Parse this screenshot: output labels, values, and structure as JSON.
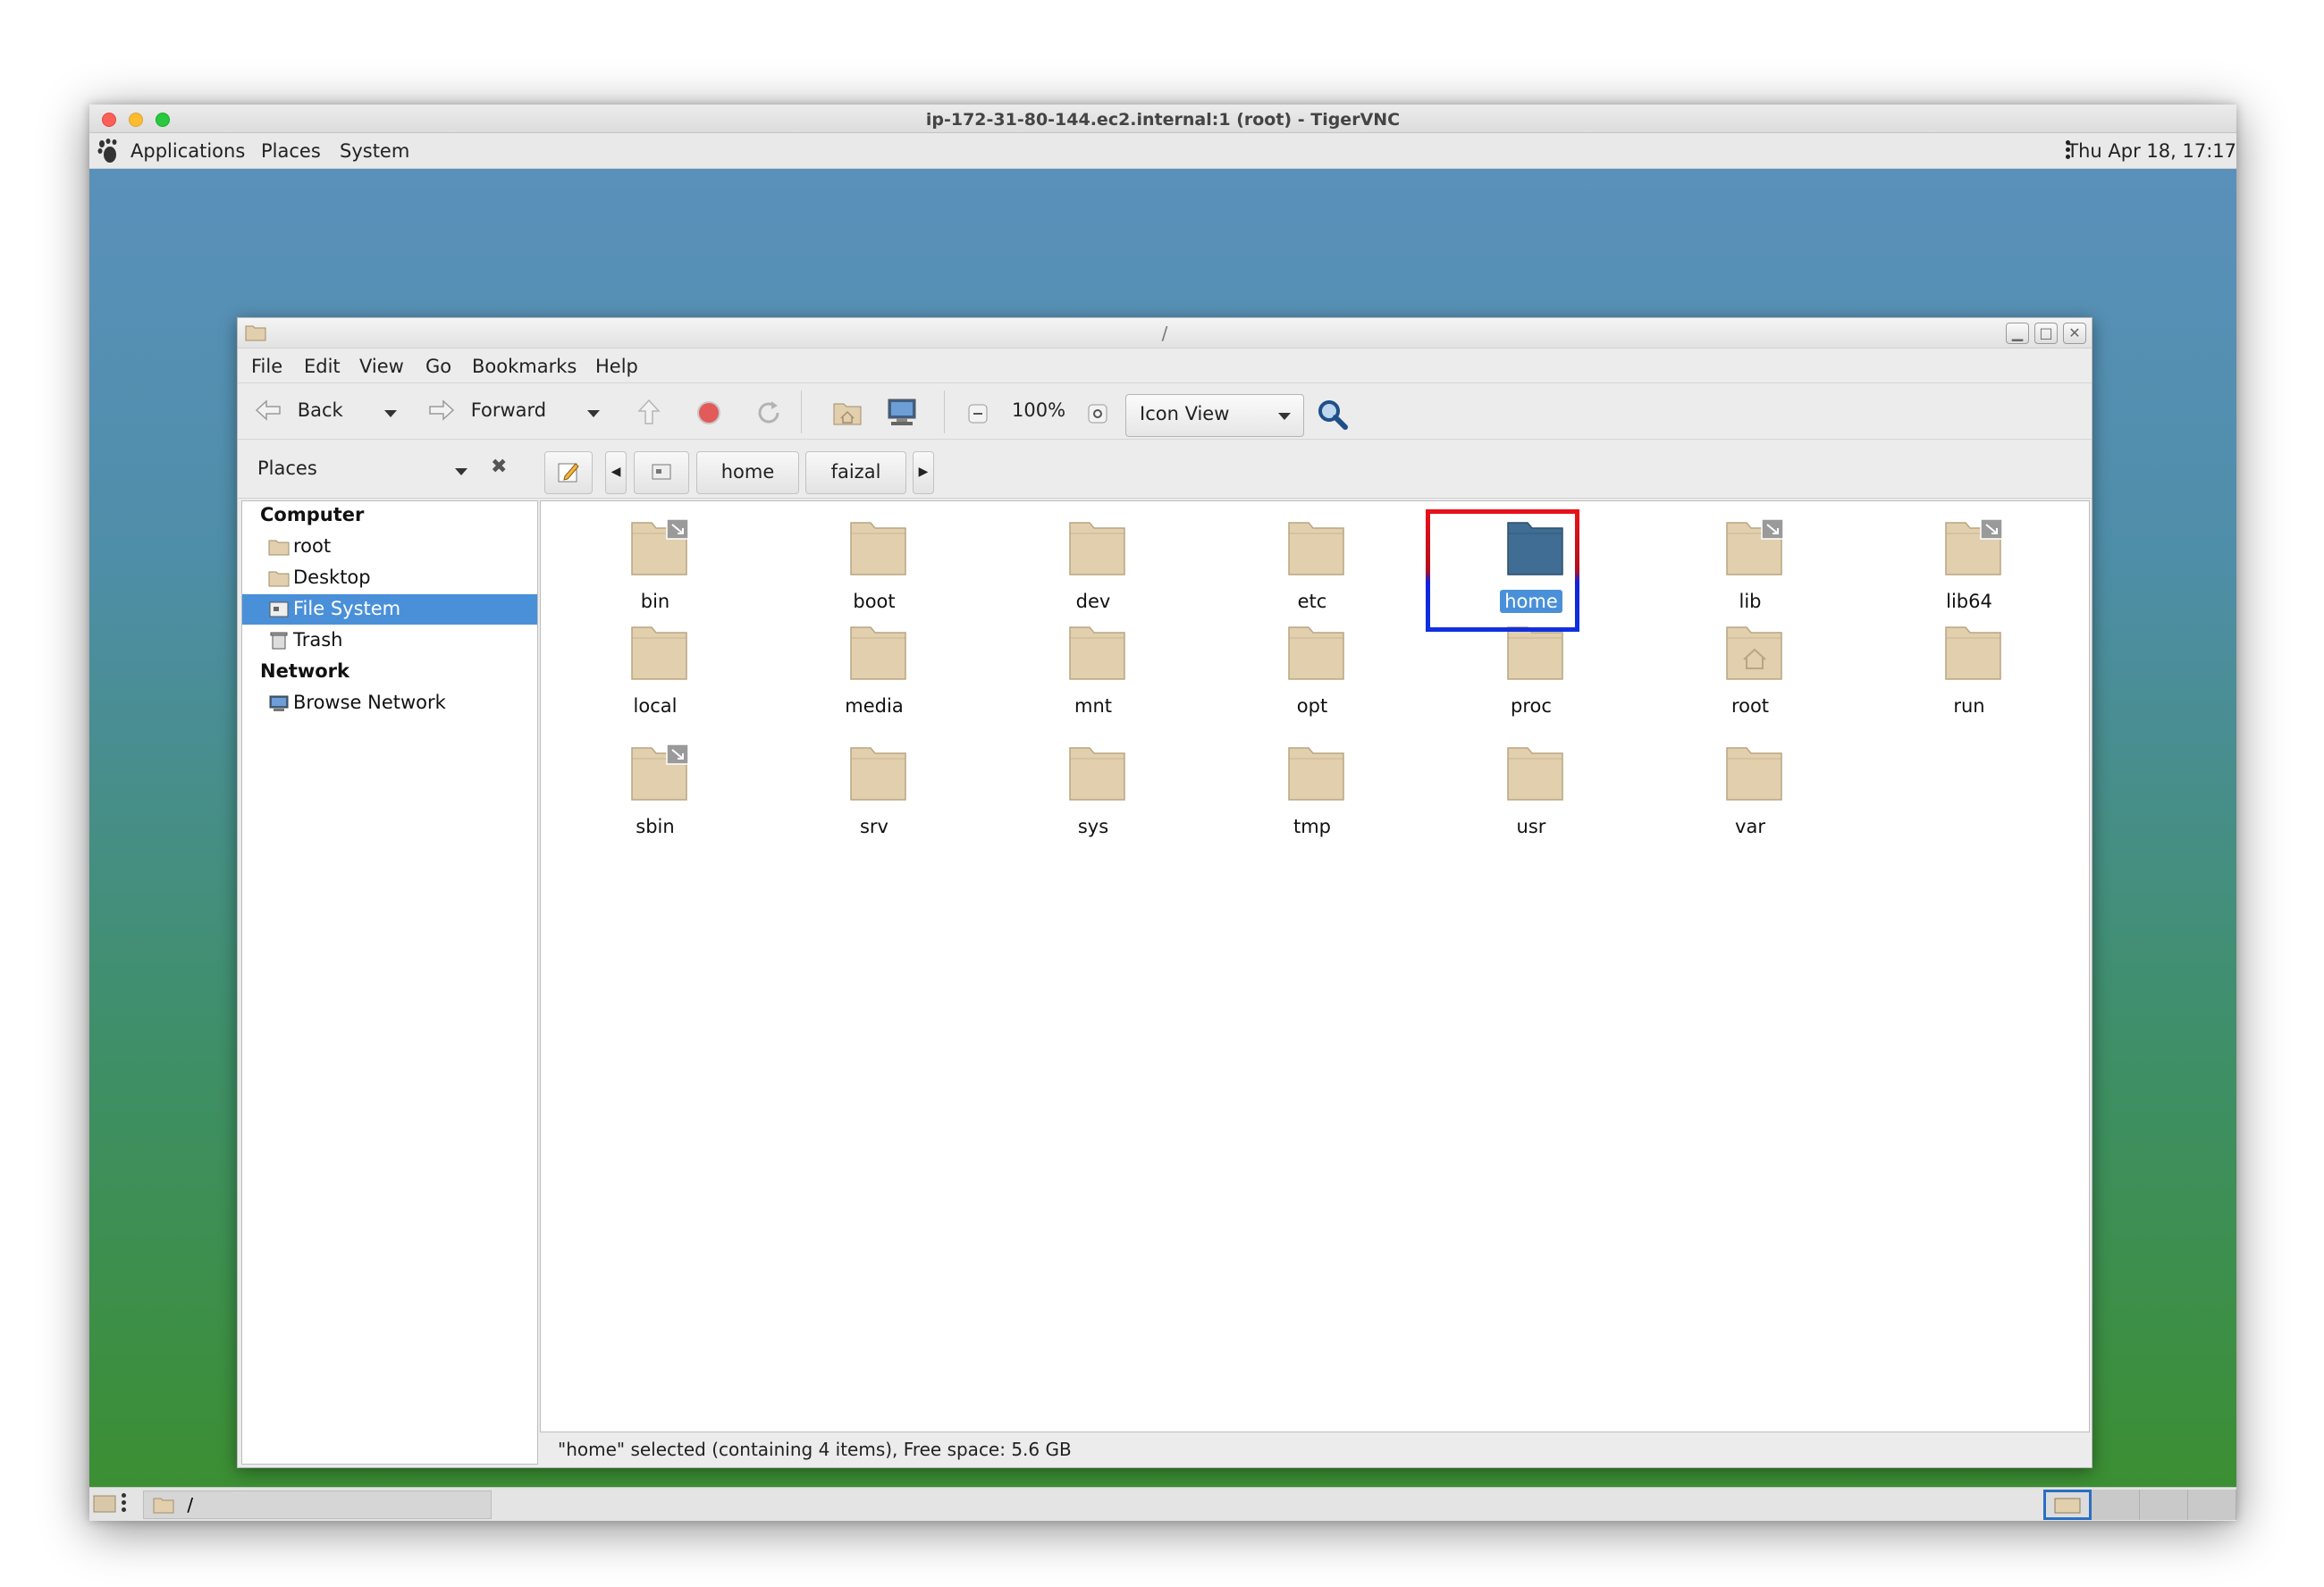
{
  "vnc": {
    "title": "ip-172-31-80-144.ec2.internal:1 (root) - TigerVNC"
  },
  "top_panel": {
    "menus": [
      "Applications",
      "Places",
      "System"
    ],
    "clock": "Thu Apr 18, 17:17"
  },
  "bottom_panel": {
    "task_label": "/"
  },
  "window": {
    "title": "/",
    "menubar": [
      "File",
      "Edit",
      "View",
      "Go",
      "Bookmarks",
      "Help"
    ],
    "toolbar": {
      "back_label": "Back",
      "forward_label": "Forward",
      "zoom_level": "100%",
      "view_mode": "Icon View"
    },
    "location": {
      "places_label": "Places",
      "breadcrumbs": [
        "home",
        "faizal"
      ]
    },
    "sidebar": {
      "computer_header": "Computer",
      "computer_items": [
        "root",
        "Desktop",
        "File System",
        "Trash"
      ],
      "network_header": "Network",
      "network_items": [
        "Browse Network"
      ],
      "selected": "File System"
    },
    "files": [
      {
        "name": "bin",
        "link": true
      },
      {
        "name": "boot"
      },
      {
        "name": "dev"
      },
      {
        "name": "etc"
      },
      {
        "name": "home",
        "selected": true
      },
      {
        "name": "lib",
        "link": true
      },
      {
        "name": "lib64",
        "link": true
      },
      {
        "name": "local"
      },
      {
        "name": "media"
      },
      {
        "name": "mnt"
      },
      {
        "name": "opt"
      },
      {
        "name": "proc"
      },
      {
        "name": "root",
        "home_emblem": true
      },
      {
        "name": "run"
      },
      {
        "name": "sbin",
        "link": true
      },
      {
        "name": "srv"
      },
      {
        "name": "sys"
      },
      {
        "name": "tmp"
      },
      {
        "name": "usr"
      },
      {
        "name": "var"
      }
    ],
    "status": "\"home\" selected (containing 4 items), Free space: 5.6 GB"
  },
  "colors": {
    "selection": "#4a90d9",
    "folder": "#e2cfae",
    "folder_selected": "#3f6d93",
    "highlight_top": "#e8101a",
    "highlight_bottom": "#1030e0"
  }
}
